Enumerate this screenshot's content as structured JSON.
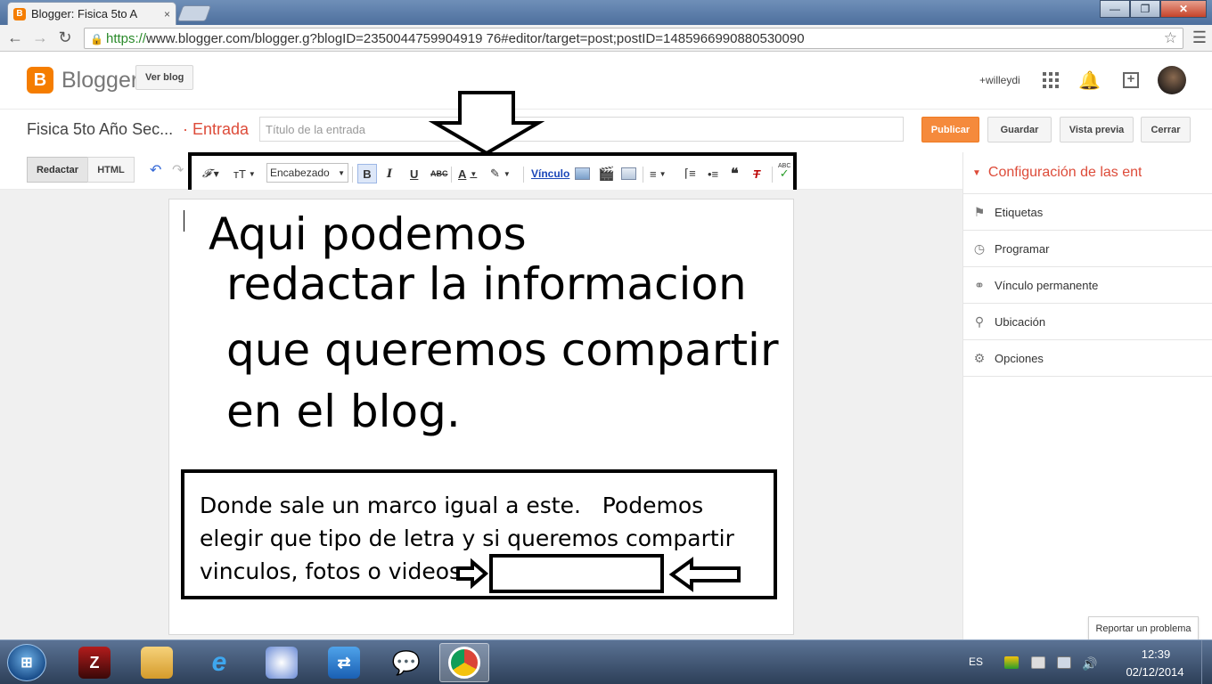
{
  "browser": {
    "tab_title": "Blogger: Fisica 5to A",
    "tab_close": "×",
    "favicon_letter": "B",
    "url_scheme": "https://",
    "url_rest": "www.blogger.com/blogger.g?blogID=2350044759904919 76#editor/target=post;postID=1485966990880530090",
    "window_controls": {
      "minimize": "—",
      "maximize": "❐",
      "close": "✕"
    }
  },
  "header": {
    "logo_letter": "B",
    "brand": "Blogger",
    "view_blog": "Ver blog",
    "user": "+willeydi"
  },
  "post": {
    "blog_title": "Fisica 5to Año Sec...",
    "mode_label": "· Entrada",
    "title_placeholder": "Título de la entrada",
    "publish": "Publicar",
    "save": "Guardar",
    "preview": "Vista previa",
    "close": "Cerrar"
  },
  "editor_tabs": {
    "compose": "Redactar",
    "html": "HTML"
  },
  "format_toolbar": {
    "font_icon": "𝓕",
    "size_icon": "тT",
    "paragraph_format": "Encabezado",
    "bold": "B",
    "italic": "I",
    "underline": "U",
    "strike": "ABC",
    "text_color": "A",
    "link": "Vínculo",
    "spellcheck": "ABC"
  },
  "editor": {
    "line1": "Aqui podemos",
    "line2": "redactar la informacion",
    "line3": "que queremos compartir",
    "line4": "en el blog.",
    "note_line1": "Donde sale un marco igual a este.   Podemos",
    "note_line2": "elegir que tipo de letra y si queremos compartir",
    "note_line3": "vinculos, fotos o videos"
  },
  "sidebar": {
    "header": "Configuración de las ent",
    "items": [
      {
        "label": "Etiquetas",
        "icon": "tag-icon"
      },
      {
        "label": "Programar",
        "icon": "clock-icon"
      },
      {
        "label": "Vínculo permanente",
        "icon": "link-icon"
      },
      {
        "label": "Ubicación",
        "icon": "pin-icon"
      },
      {
        "label": "Opciones",
        "icon": "gear-icon"
      }
    ]
  },
  "report_problem": "Reportar un problema",
  "taskbar": {
    "language": "ES",
    "time": "12:39",
    "date": "02/12/2014"
  },
  "colors": {
    "accent_orange": "#f57d00",
    "publish_orange": "#f58a3c",
    "entry_red": "#dd4b39",
    "url_green": "#2a8a2a"
  }
}
